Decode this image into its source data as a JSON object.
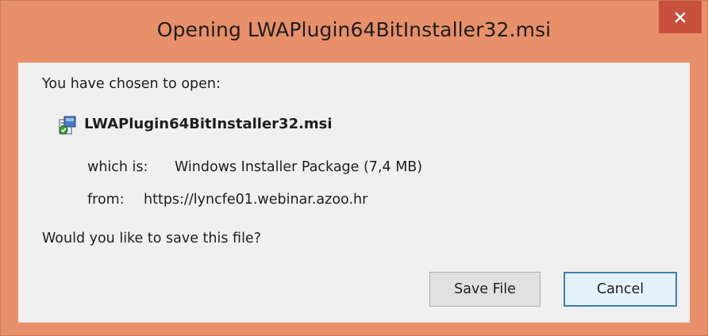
{
  "window": {
    "title": "Opening LWAPlugin64BitInstaller32.msi",
    "accent_color": "#e8906a",
    "close_icon": "close-icon"
  },
  "dialog": {
    "intro": "You have chosen to open:",
    "file_name": "LWAPlugin64BitInstaller32.msi",
    "file_icon": "msi-package-icon",
    "which_is_label": "which is:",
    "which_is_value": "Windows Installer Package (7,4 MB)",
    "from_label": "from:",
    "from_value": "https://lyncfe01.webinar.azoo.hr",
    "question": "Would you like to save this file?"
  },
  "buttons": {
    "save_label": "Save File",
    "cancel_label": "Cancel"
  }
}
